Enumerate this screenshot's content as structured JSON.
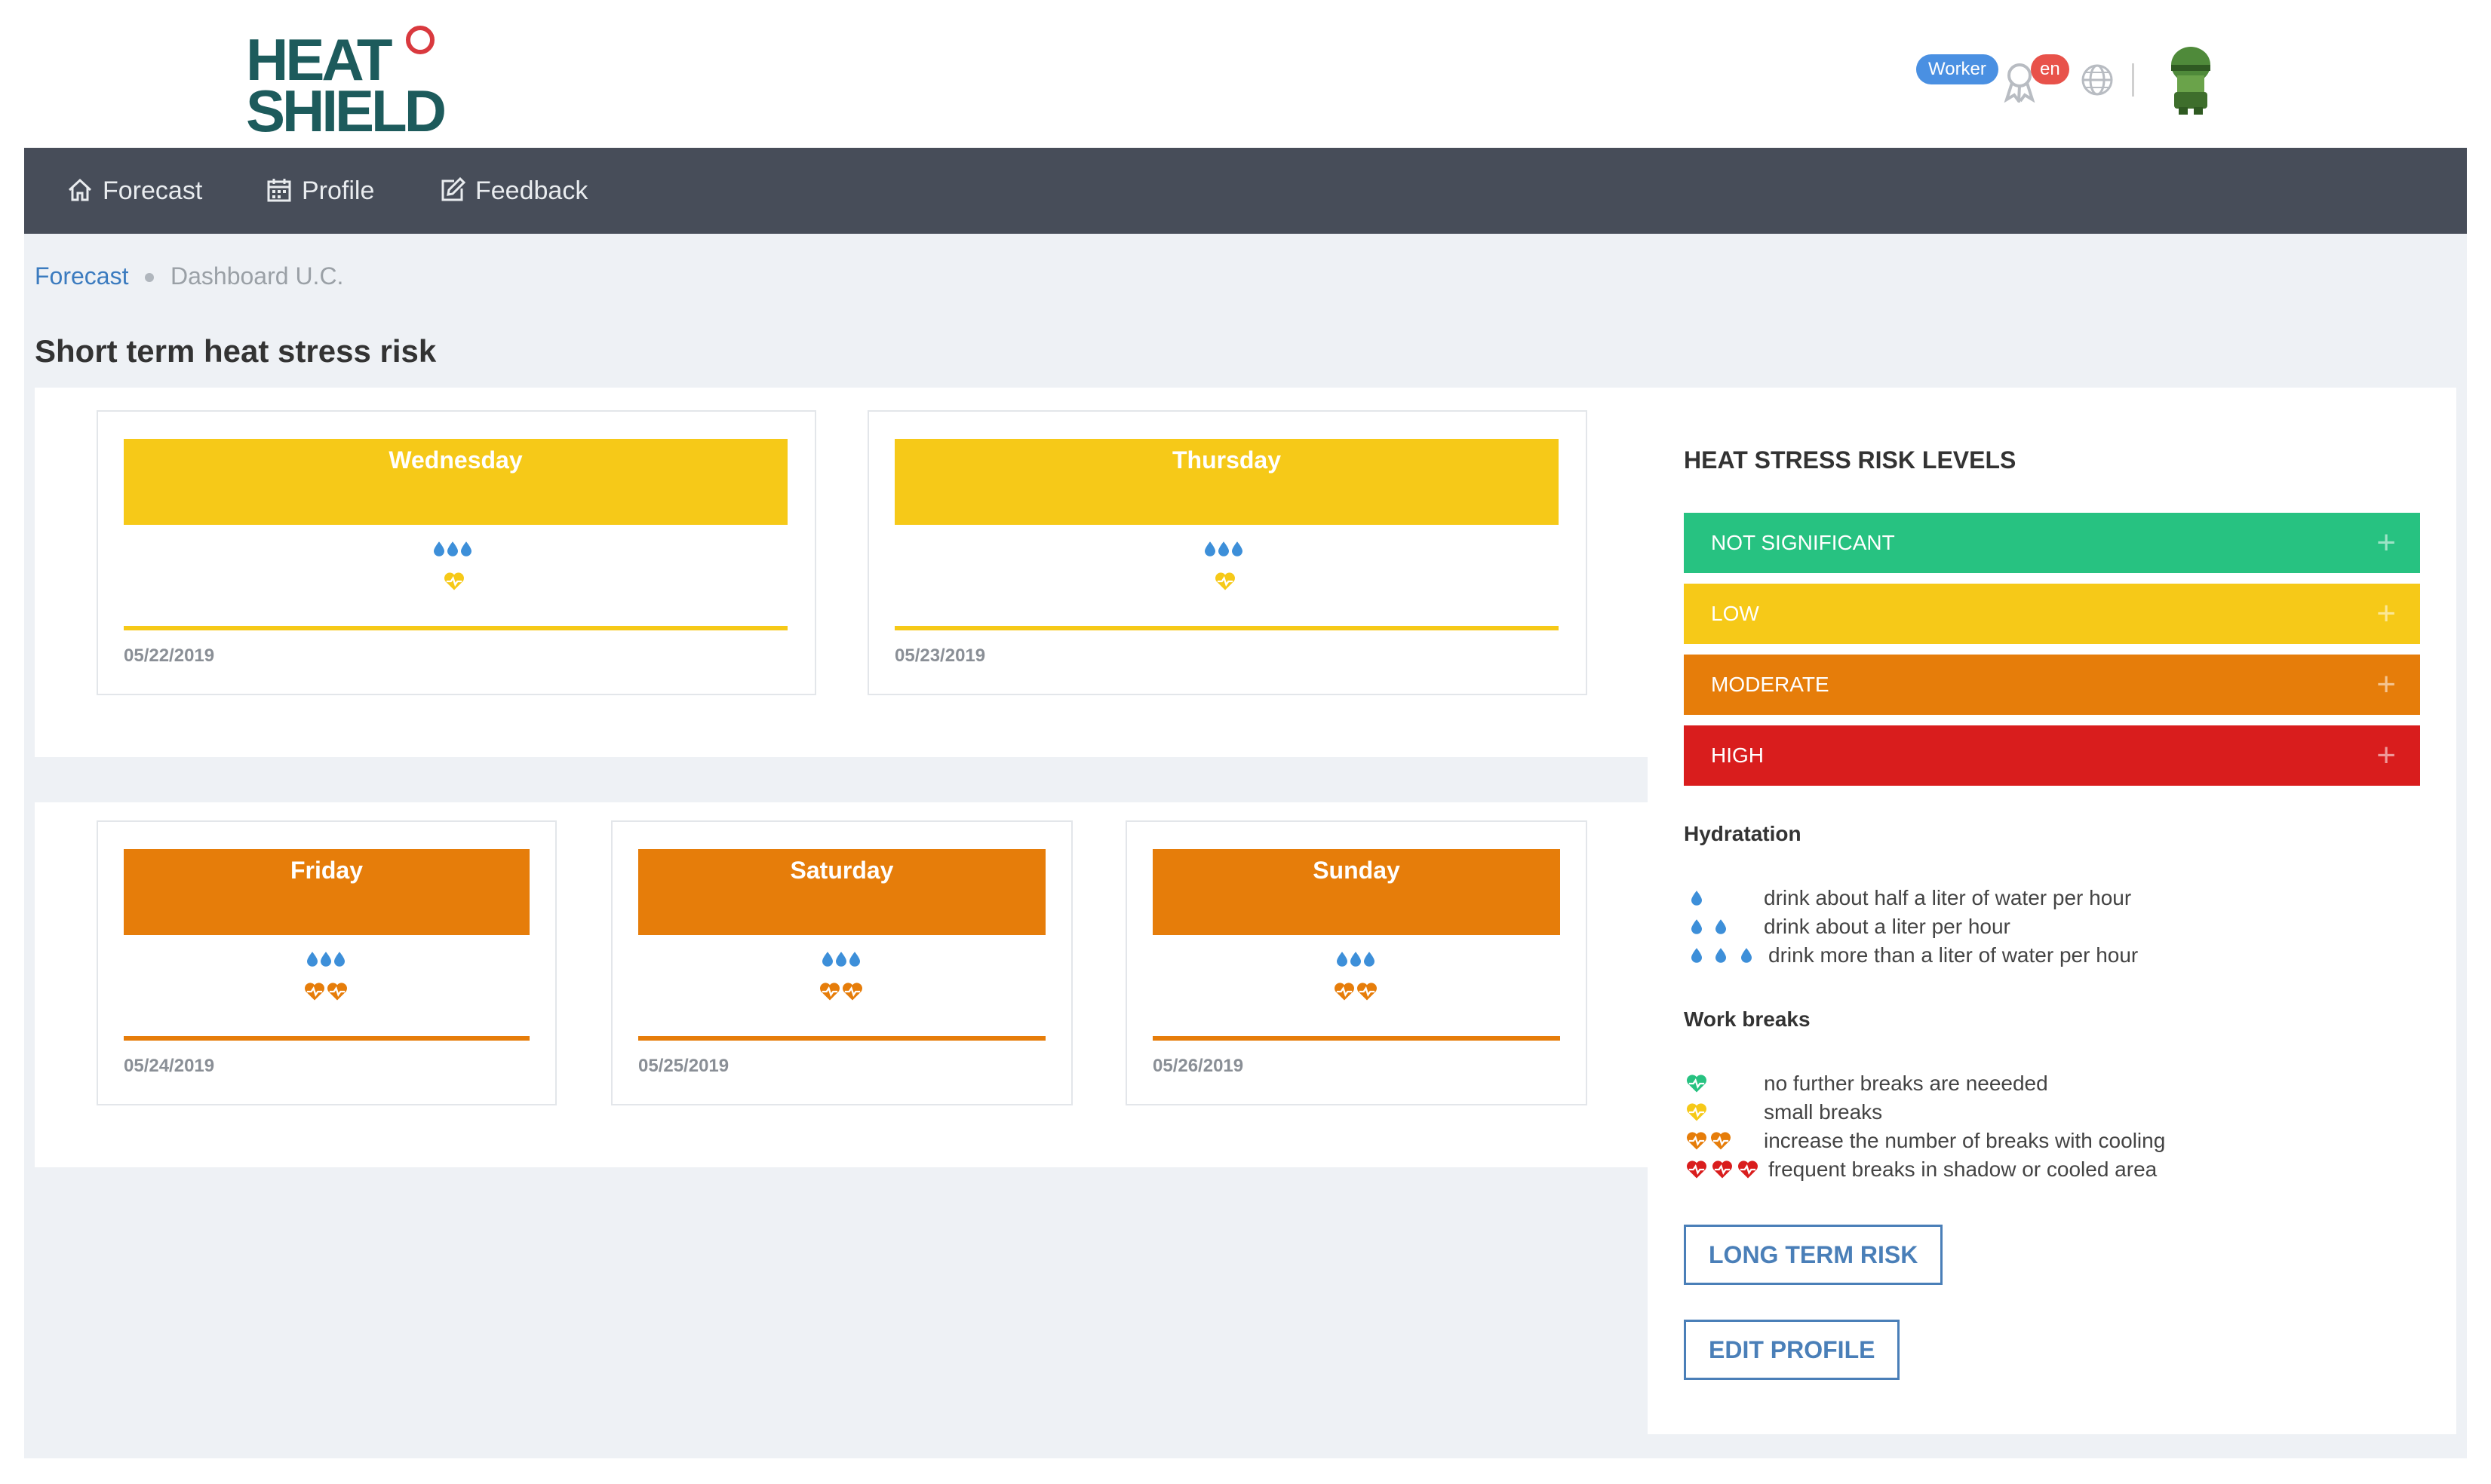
{
  "header": {
    "logo_line1": "HEAT",
    "logo_line2": "SHIELD",
    "role_badge": "Worker",
    "lang_badge": "en"
  },
  "nav": {
    "items": [
      {
        "label": "Forecast",
        "icon": "home-icon"
      },
      {
        "label": "Profile",
        "icon": "calendar-icon"
      },
      {
        "label": "Feedback",
        "icon": "edit-icon"
      }
    ]
  },
  "breadcrumb": {
    "link": "Forecast",
    "current": "Dashboard U.C."
  },
  "page_title": "Short term heat stress risk",
  "forecast": {
    "days": [
      {
        "day": "Wednesday",
        "date": "05/22/2019",
        "risk": "low",
        "color": "#f6c918",
        "drops": 3,
        "hearts": 1
      },
      {
        "day": "Thursday",
        "date": "05/23/2019",
        "risk": "low",
        "color": "#f6c918",
        "drops": 3,
        "hearts": 1
      },
      {
        "day": "Friday",
        "date": "05/24/2019",
        "risk": "moderate",
        "color": "#e67d0a",
        "drops": 3,
        "hearts": 2
      },
      {
        "day": "Saturday",
        "date": "05/25/2019",
        "risk": "moderate",
        "color": "#e67d0a",
        "drops": 3,
        "hearts": 2
      },
      {
        "day": "Sunday",
        "date": "05/26/2019",
        "risk": "moderate",
        "color": "#e67d0a",
        "drops": 3,
        "hearts": 2
      }
    ]
  },
  "legend": {
    "title": "HEAT STRESS RISK LEVELS",
    "levels": [
      {
        "label": "NOT SIGNIFICANT",
        "color": "#27c281"
      },
      {
        "label": "LOW",
        "color": "#f6c918"
      },
      {
        "label": "MODERATE",
        "color": "#e67d0a"
      },
      {
        "label": "HIGH",
        "color": "#d91d1d"
      }
    ],
    "hydration_title": "Hydratation",
    "hydration": [
      "drink about half a liter of water per hour",
      "drink about a liter per hour",
      "drink more than a liter of water per hour"
    ],
    "breaks_title": "Work breaks",
    "breaks": [
      "no further breaks are neeeded",
      "small breaks",
      "increase the number of breaks with cooling",
      "frequent breaks in shadow or cooled area"
    ]
  },
  "buttons": {
    "long_term": "LONG TERM RISK",
    "edit_profile": "EDIT PROFILE"
  }
}
